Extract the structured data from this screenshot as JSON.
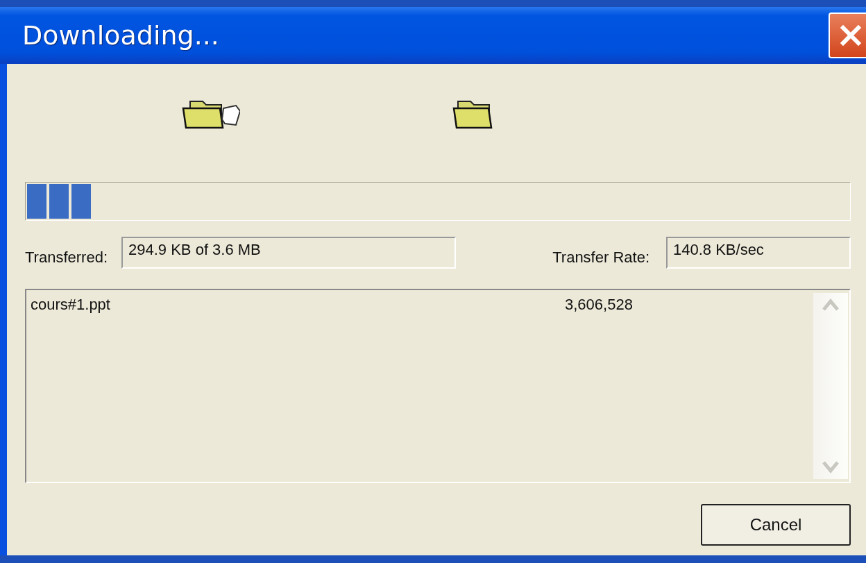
{
  "window": {
    "title": "Downloading..."
  },
  "progress": {
    "level": 0.08
  },
  "transferred": {
    "label": "Transferred:",
    "value": "294.9 KB of 3.6 MB"
  },
  "rate": {
    "label": "Transfer Rate:",
    "value": "140.8 KB/sec"
  },
  "files": [
    {
      "name": "cours#1.ppt",
      "size": "3,606,528"
    }
  ],
  "buttons": [
    "Cancel"
  ]
}
